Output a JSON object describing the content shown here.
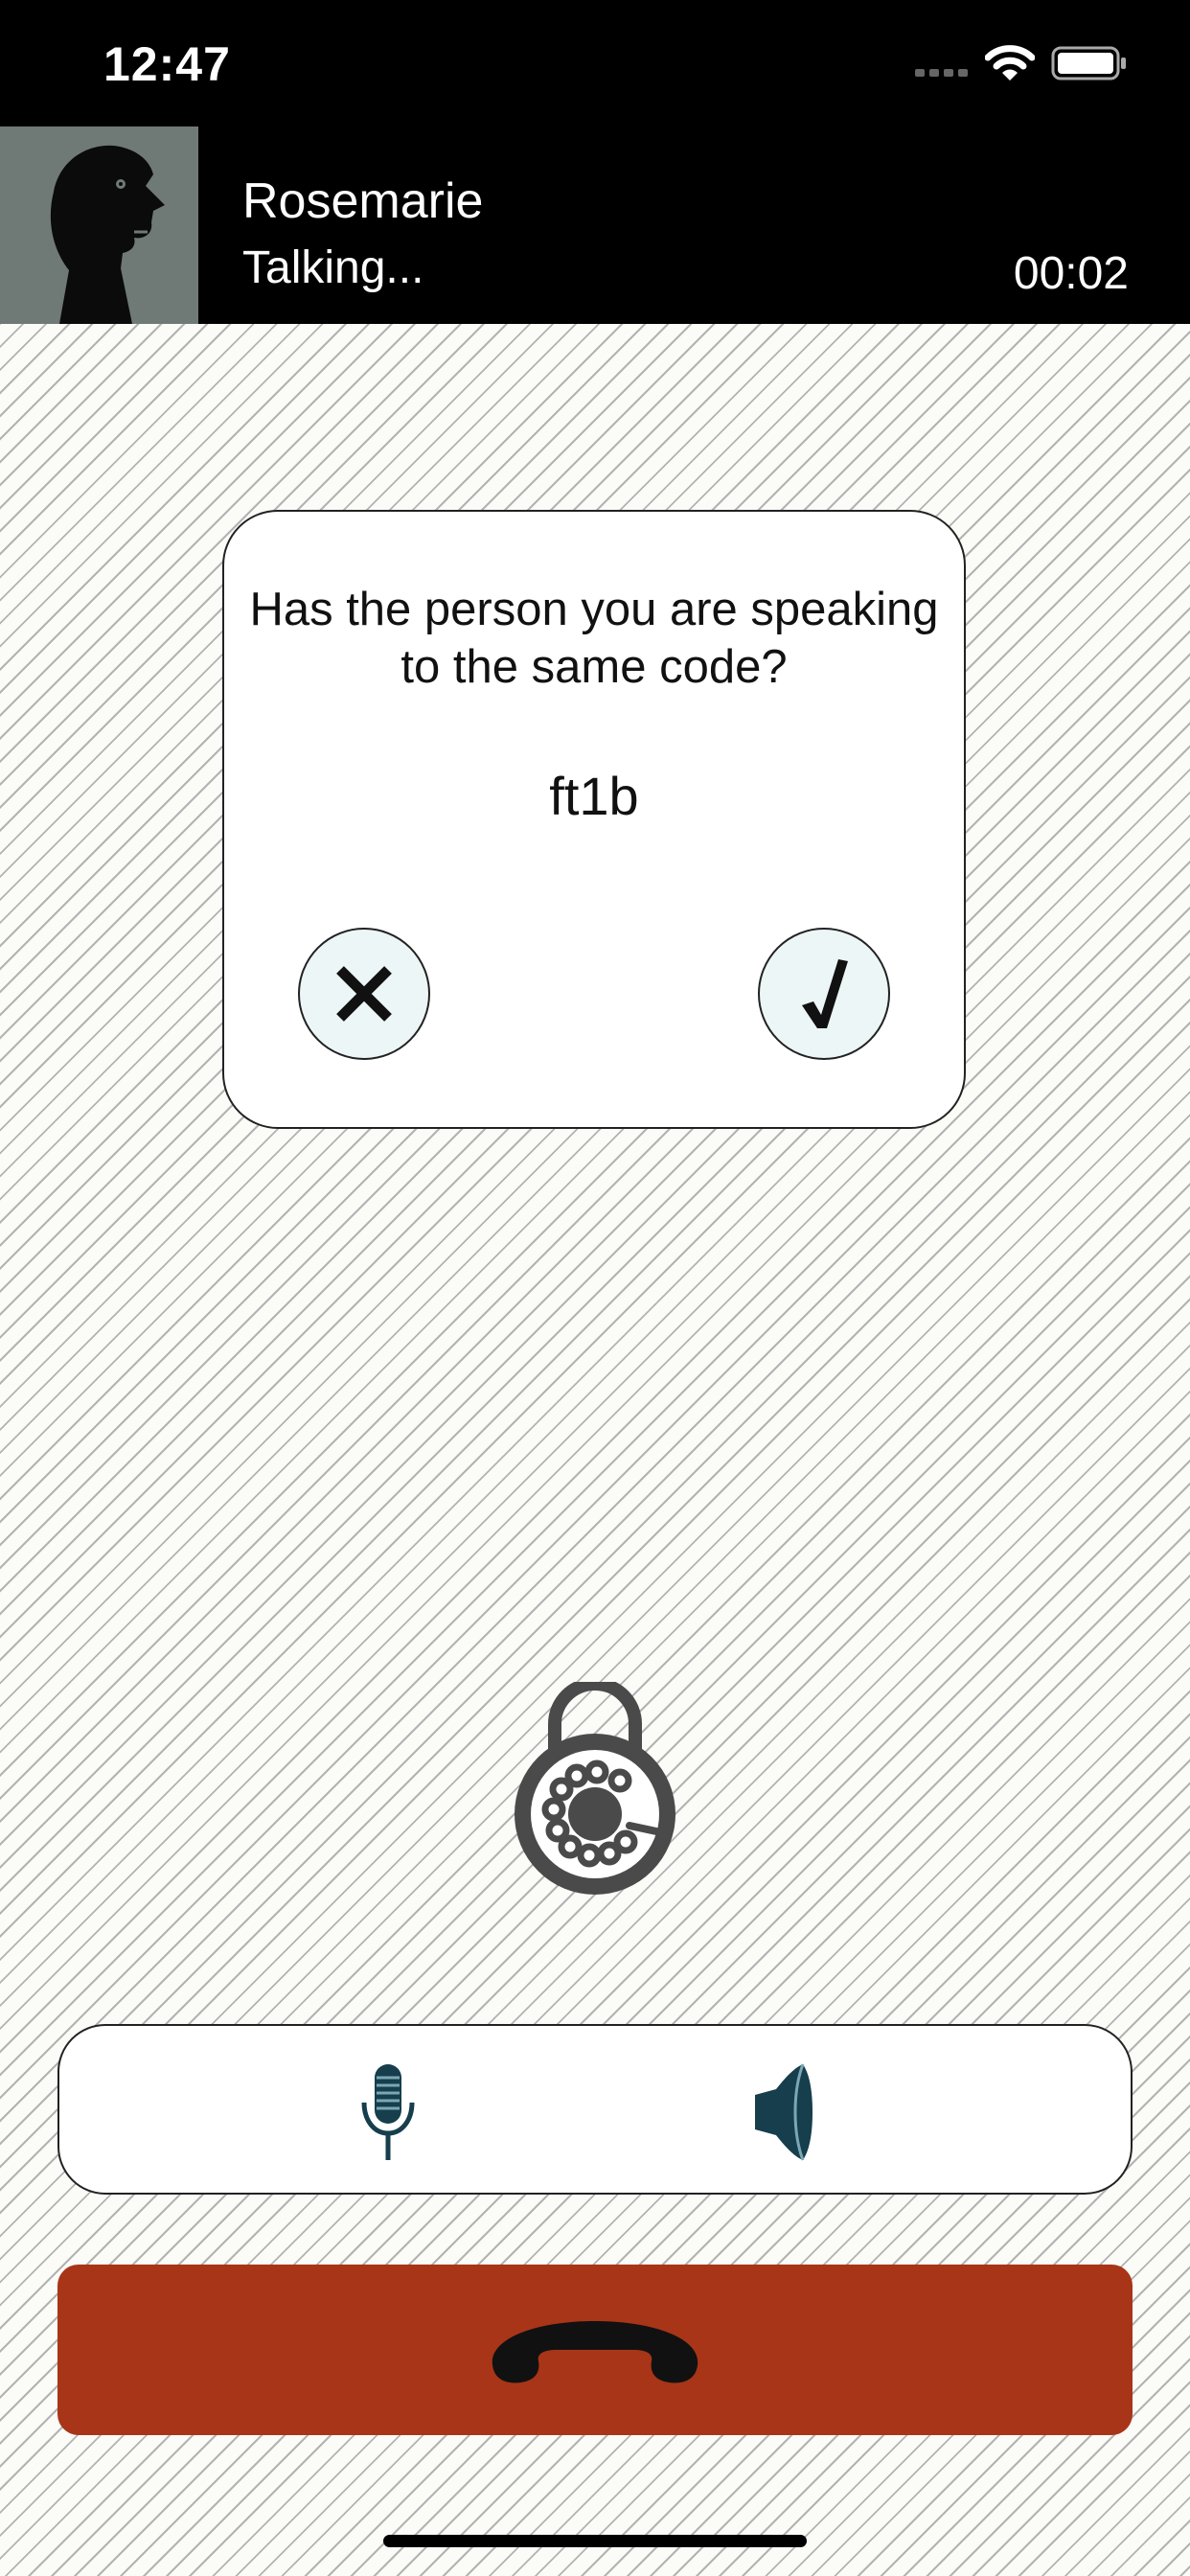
{
  "status_bar": {
    "time": "12:47"
  },
  "call": {
    "contact_name": "Rosemarie",
    "status": "Talking...",
    "duration": "00:02"
  },
  "verification": {
    "question": "Has the person you are speaking to the same code?",
    "code": "ft1b"
  },
  "icons": {
    "avatar": "profile-silhouette-icon",
    "reject": "x-icon",
    "confirm": "checkmark-icon",
    "lock": "rotary-lock-icon",
    "mic": "microphone-icon",
    "speaker": "speaker-icon",
    "hangup": "phone-handset-icon"
  },
  "colors": {
    "header_bg": "#000000",
    "hangup_bg": "#a83518",
    "icon_dark": "#163e4c",
    "lock_gray": "#4a4a4a",
    "dialog_button_bg": "#ecf6f7"
  }
}
